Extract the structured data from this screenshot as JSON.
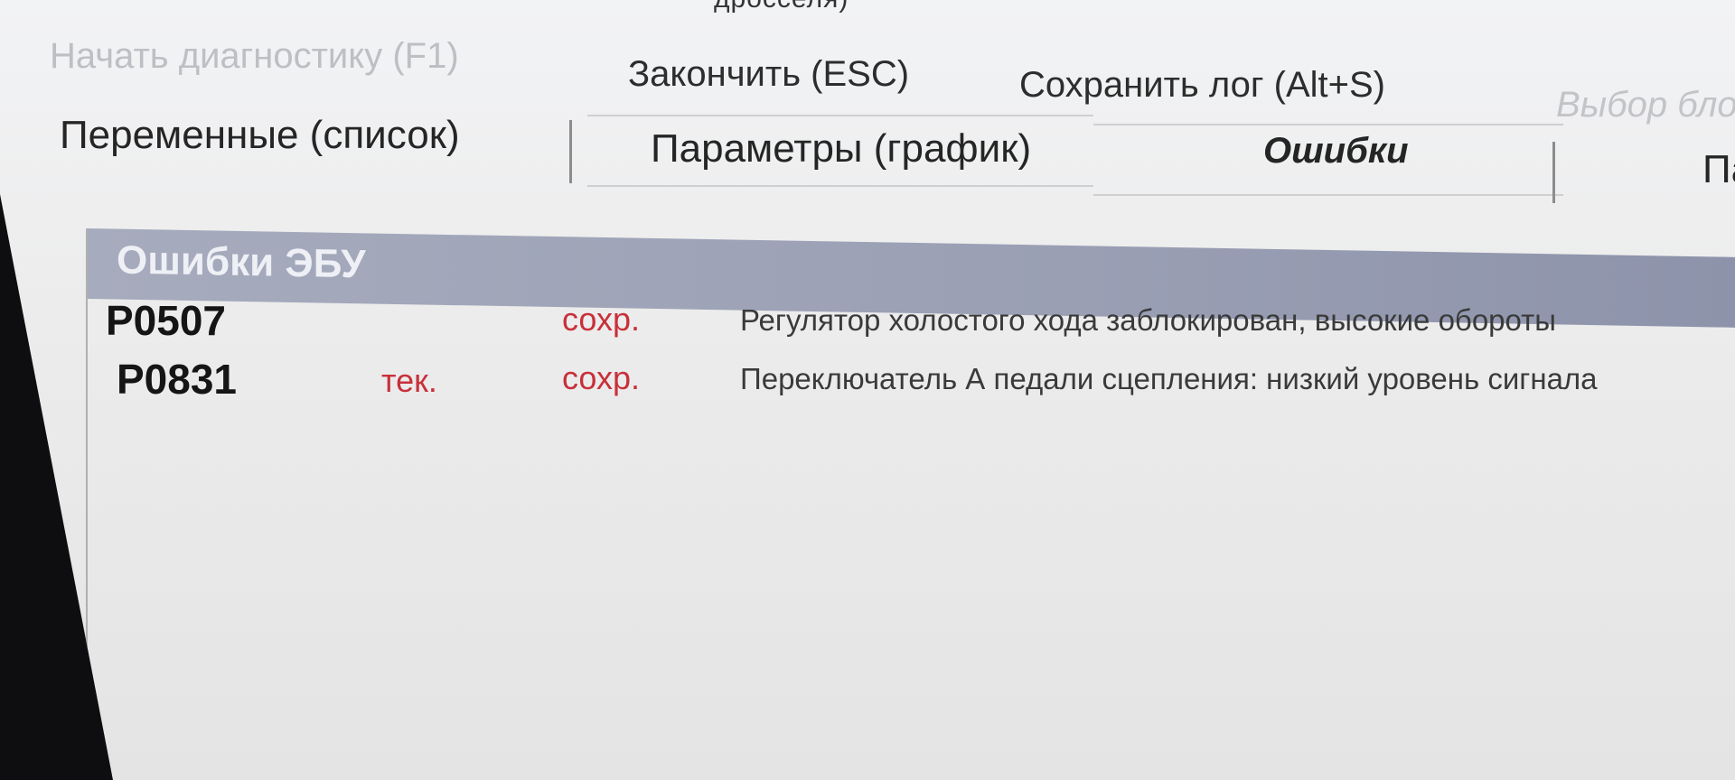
{
  "window": {
    "title_fragment": "дросселя)"
  },
  "toolbar": {
    "start_label": "Начать диагностику (F1)",
    "stop_label": "Закончить (ESC)",
    "save_label": "Сохранить лог (Alt+S)",
    "block_label": "Выбор блока"
  },
  "tabs": [
    {
      "label": "Переменные (список)"
    },
    {
      "label": "Параметры (график)"
    },
    {
      "label": "Ошибки"
    },
    {
      "label": "Па"
    }
  ],
  "panel": {
    "title": "Ошибки ЭБУ",
    "errors": [
      {
        "code": "P0507",
        "current": "",
        "saved": "сохр.",
        "description": "Регулятор холостого хода заблокирован, высокие обороты"
      },
      {
        "code": "P0831",
        "current": "тек.",
        "saved": "сохр.",
        "description": "Переключатель А педали сцепления: низкий уровень сигнала"
      }
    ]
  },
  "colors": {
    "header_bg": "#9a9fb4",
    "flag_red": "#c8303a",
    "disabled_text": "#bdbfc4"
  }
}
